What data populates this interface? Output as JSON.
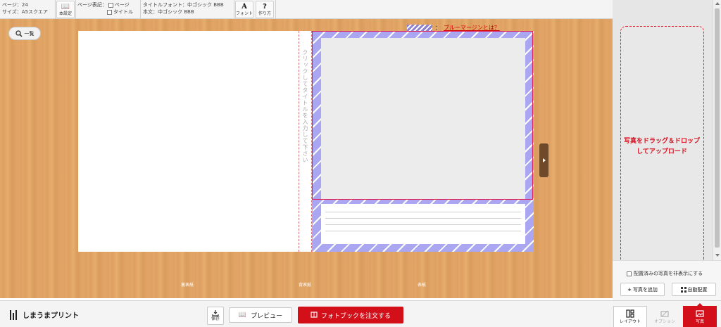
{
  "toolbar": {
    "page_info": "ページ：24",
    "size_info": "サイズ：A5スクエア",
    "book_settings": {
      "icon": "book-icon",
      "label": "本設定"
    },
    "page_display_label": "ページ表記：",
    "page_display_options": [
      "ページ",
      "タイトル"
    ],
    "title_font": "タイトルフォント：中ゴシック BBB",
    "body_font": "本文：中ゴシック BBB",
    "font_button": {
      "icon": "A",
      "label": "フォント"
    },
    "howto_button": {
      "icon": "?",
      "label": "作り方"
    }
  },
  "workspace": {
    "list_button": "一覧",
    "bleed_colon": "：",
    "bleed_link": "ブルーマージンとは？",
    "spine_placeholder": "クリックしてタイトルを入力して下さい",
    "labels": {
      "back_cover": "裏表紙",
      "spine": "背表紙",
      "front_cover": "表紙"
    },
    "colors": {
      "bleed": "#aaa6f2",
      "accent_red": "#d3101a",
      "guide": "#e0205a"
    }
  },
  "right_panel": {
    "dropzone_text": "写真をドラッグ＆ドロップしてアップロード",
    "hide_placed": "配置済みの写真を非表示にする",
    "add_photo": "写真を追加",
    "auto_place": "自動配置"
  },
  "bottombar": {
    "logo": "しまうまプリント",
    "save": "保存",
    "preview": "プレビュー",
    "order": "フォトブックを注文する",
    "tabs": [
      "レイアウト",
      "オプション",
      "写真"
    ]
  }
}
